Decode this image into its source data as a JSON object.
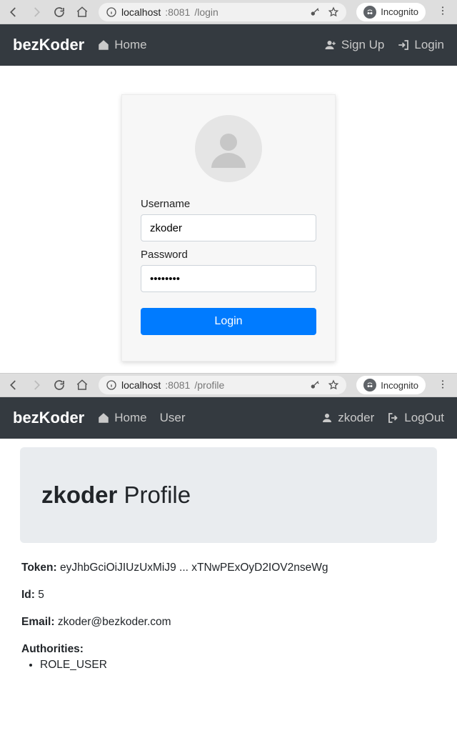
{
  "chrome": {
    "host": "localhost",
    "port": ":8081",
    "path_login": "/login",
    "path_profile": "/profile",
    "incognito_label": "Incognito"
  },
  "navbar": {
    "brand": "bezKoder",
    "home": "Home",
    "user": "User",
    "signup": "Sign Up",
    "login": "Login",
    "logout": "LogOut",
    "username": "zkoder"
  },
  "login": {
    "username_label": "Username",
    "username_value": "zkoder",
    "password_label": "Password",
    "password_value": "••••••••",
    "submit": "Login"
  },
  "profile": {
    "name": "zkoder",
    "title_suffix": " Profile",
    "token_label": "Token:",
    "token_value": "eyJhbGciOiJIUzUxMiJ9 ... xTNwPExOyD2IOV2nseWg",
    "id_label": "Id:",
    "id_value": "5",
    "email_label": "Email:",
    "email_value": "zkoder@bezkoder.com",
    "authorities_label": "Authorities:",
    "authorities": [
      "ROLE_USER"
    ]
  }
}
